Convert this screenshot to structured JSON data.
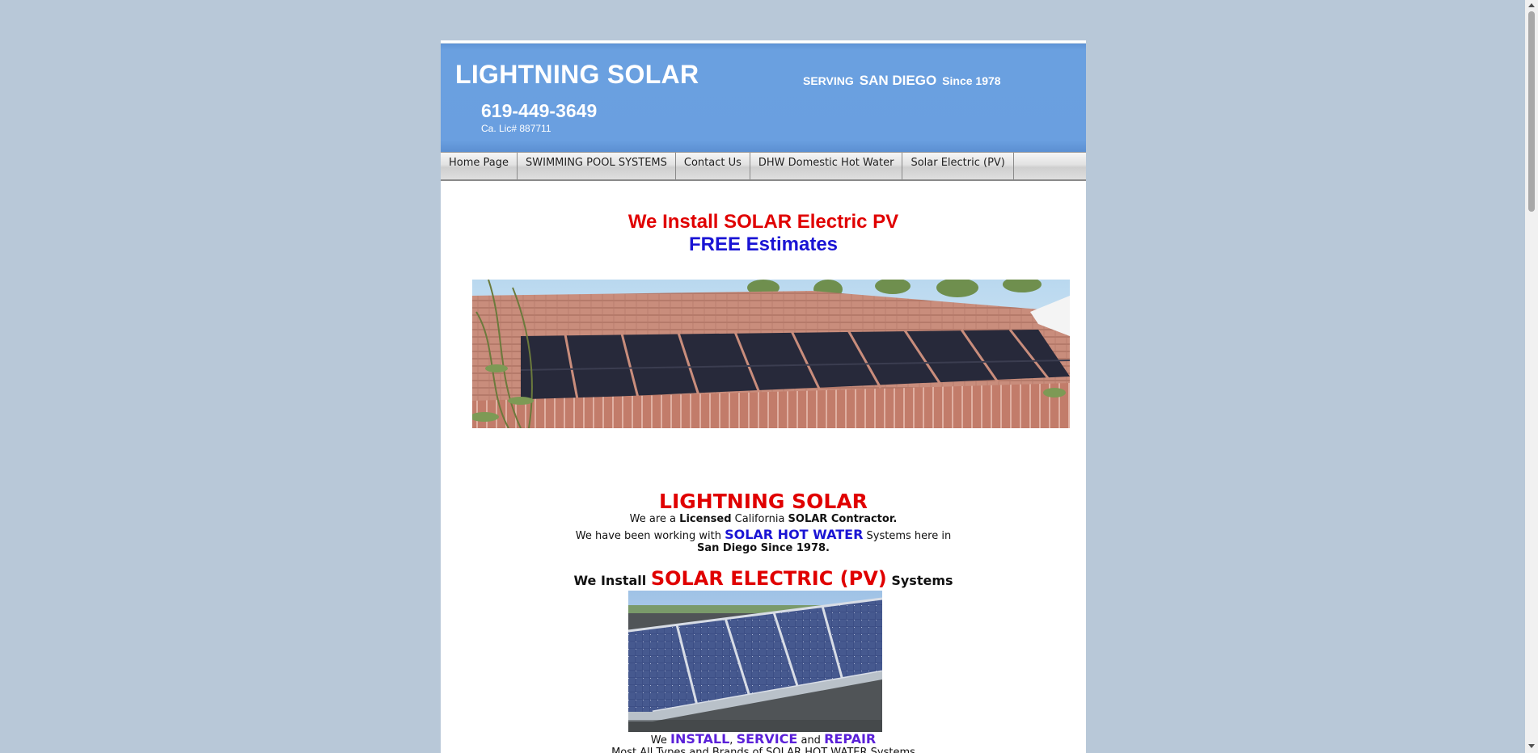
{
  "header": {
    "brand": "LIGHTNING SOLAR",
    "phone": "619-449-3649",
    "license": "Ca. Lic# 887711",
    "tagline_serving": "SERVING",
    "tagline_city": "SAN DIEGO",
    "tagline_since": "Since 1978"
  },
  "nav": {
    "items": [
      {
        "label": "Home Page"
      },
      {
        "label": "SWIMMING POOL SYSTEMS"
      },
      {
        "label": "Contact Us"
      },
      {
        "label": "DHW Domestic Hot Water"
      },
      {
        "label": "Solar Electric (PV)"
      }
    ]
  },
  "hero": {
    "line1": "We Install SOLAR Electric PV",
    "line2": "FREE Estimates"
  },
  "about": {
    "title": "LIGHTNING SOLAR",
    "line1_a": "We are a ",
    "line1_b": "Licensed",
    "line1_c": " California ",
    "line1_d": "SOLAR Contractor.",
    "line2_a": "We have been working with ",
    "line2_b": "SOLAR HOT WATER",
    "line2_c": " Systems here in",
    "line3": "San Diego Since 1978."
  },
  "pv": {
    "pre": "We Install ",
    "big": "SOLAR ELECTRIC (PV)",
    "post": " Systems"
  },
  "service": {
    "we": "We ",
    "install": "INSTALL",
    "comma": ", ",
    "service": "SERVICE",
    "and": " and ",
    "repair": "REPAIR",
    "cutoff": "Most All Types and Brands of SOLAR HOT WATER Systems"
  },
  "colors": {
    "page_bg": "#b8c8d8",
    "header_blue": "#6aa0e0",
    "headline_red": "#e00000",
    "headline_blue": "#1a14d4"
  }
}
